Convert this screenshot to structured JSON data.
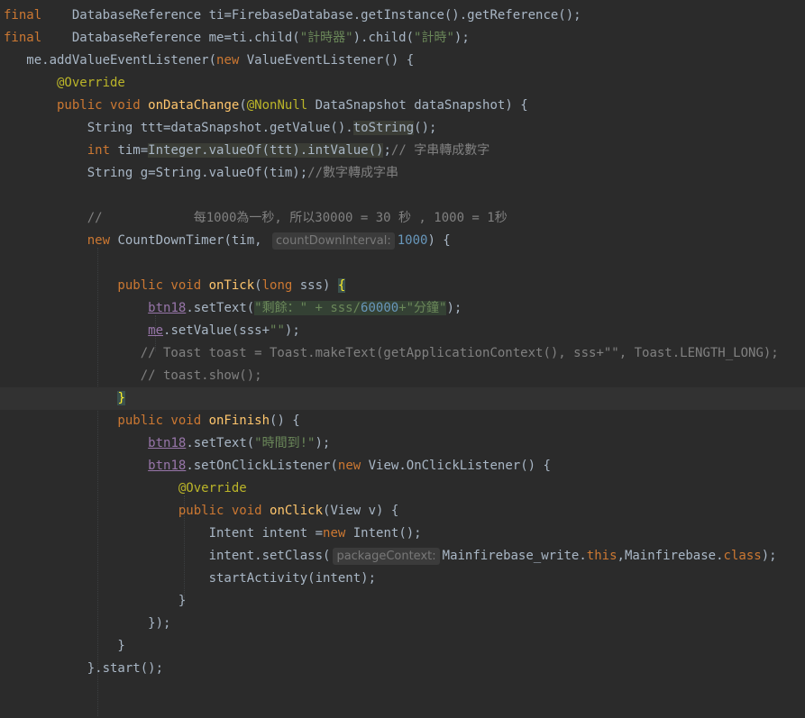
{
  "editor": {
    "lines": [
      [
        [
          "kw",
          "final"
        ],
        [
          "",
          "    DatabaseReference ti=FirebaseDatabase.getInstance().getReference();"
        ]
      ],
      [
        [
          "kw",
          "final"
        ],
        [
          "",
          "    DatabaseReference me=ti.child("
        ],
        [
          "str",
          "\"計時器\""
        ],
        [
          "",
          ").child("
        ],
        [
          "str",
          "\"計時\""
        ],
        [
          "",
          ");"
        ]
      ],
      [
        [
          "",
          "   me.addValueEventListener("
        ],
        [
          "kw",
          "new"
        ],
        [
          "",
          " ValueEventListener() {"
        ]
      ],
      [
        [
          "ann",
          "       @Override"
        ]
      ],
      [
        [
          "kw",
          "       public void "
        ],
        [
          "fn",
          "onDataChange"
        ],
        [
          "",
          "("
        ],
        [
          "ann",
          "@NonNull"
        ],
        [
          "",
          " DataSnapshot dataSnapshot) {"
        ]
      ],
      [
        [
          "",
          "           String ttt=dataSnapshot.getValue()."
        ],
        [
          "hl2",
          "toString"
        ],
        [
          "",
          "();"
        ]
      ],
      [
        [
          "kw",
          "           int"
        ],
        [
          "",
          " tim="
        ],
        [
          "hl2",
          "Integer.valueOf(ttt).intValue()"
        ],
        [
          "",
          ";"
        ],
        [
          "cmt",
          "// 字串轉成數字"
        ]
      ],
      [
        [
          "",
          "           String "
        ],
        [
          "und",
          "g"
        ],
        [
          "",
          "=String.valueOf(tim);"
        ],
        [
          "cmt",
          "//數字轉成字串"
        ]
      ],
      [
        [
          "",
          ""
        ]
      ],
      [
        [
          "cmt",
          "           //            每1000為一秒, 所以30000 = 30 秒 , 1000 = 1秒"
        ]
      ],
      [
        [
          "kw",
          "           new"
        ],
        [
          "",
          " CountDownTimer(tim, "
        ],
        [
          "hint",
          "countDownInterval:"
        ],
        [
          "num",
          "1000"
        ],
        [
          "",
          ") {"
        ]
      ],
      [
        [
          "",
          ""
        ]
      ],
      [
        [
          "kw",
          "               public void "
        ],
        [
          "fn",
          "onTick"
        ],
        [
          "",
          "("
        ],
        [
          "kw",
          "long"
        ],
        [
          "",
          " sss) "
        ],
        [
          "brace-match",
          "{"
        ]
      ],
      [
        [
          "",
          "                   "
        ],
        [
          "field und",
          "btn18"
        ],
        [
          "",
          ".setText("
        ],
        [
          "str hl",
          "\"剩餘：\" + sss/"
        ],
        [
          "num hl",
          "60000"
        ],
        [
          "str hl",
          "+\"分鐘\""
        ],
        [
          "",
          ");"
        ]
      ],
      [
        [
          "",
          "                   "
        ],
        [
          "field und",
          "me"
        ],
        [
          "",
          ".setValue(sss+"
        ],
        [
          "str",
          "\"\""
        ],
        [
          "",
          ");"
        ]
      ],
      [
        [
          "cmt",
          "                  // Toast toast = Toast.makeText(getApplicationContext(), sss+\"\", Toast.LENGTH_LONG);"
        ]
      ],
      [
        [
          "cmt",
          "                  // toast.show();"
        ]
      ],
      [
        [
          "",
          "               "
        ],
        [
          "brace-match",
          "}"
        ]
      ],
      [
        [
          "kw",
          "               public void "
        ],
        [
          "fn",
          "onFinish"
        ],
        [
          "",
          "() {"
        ]
      ],
      [
        [
          "",
          "                   "
        ],
        [
          "field und",
          "btn18"
        ],
        [
          "",
          ".setText("
        ],
        [
          "str",
          "\"時間到!\""
        ],
        [
          "",
          ");"
        ]
      ],
      [
        [
          "",
          "                   "
        ],
        [
          "field und",
          "btn18"
        ],
        [
          "",
          ".setOnClickListener("
        ],
        [
          "kw",
          "new"
        ],
        [
          "",
          " View.OnClickListener() {"
        ]
      ],
      [
        [
          "ann",
          "                       @Override"
        ]
      ],
      [
        [
          "kw",
          "                       public void "
        ],
        [
          "fn",
          "onClick"
        ],
        [
          "",
          "(View v) {"
        ]
      ],
      [
        [
          "",
          "                           Intent intent ="
        ],
        [
          "kw",
          "new"
        ],
        [
          "",
          " Intent();"
        ]
      ],
      [
        [
          "",
          "                           intent.setClass("
        ],
        [
          "hint",
          "packageContext:"
        ],
        [
          "",
          "Mainfirebase_write."
        ],
        [
          "kw",
          "this"
        ],
        [
          "",
          ",Mainfirebase."
        ],
        [
          "kw",
          "class"
        ],
        [
          "",
          ");"
        ]
      ],
      [
        [
          "",
          "                           startActivity(intent);"
        ]
      ],
      [
        [
          "",
          "                       }"
        ]
      ],
      [
        [
          "",
          "                   });"
        ]
      ],
      [
        [
          "",
          "               }"
        ]
      ],
      [
        [
          "",
          "           }.start();"
        ]
      ],
      [
        [
          "",
          ""
        ]
      ],
      [
        [
          "",
          ""
        ]
      ]
    ]
  }
}
